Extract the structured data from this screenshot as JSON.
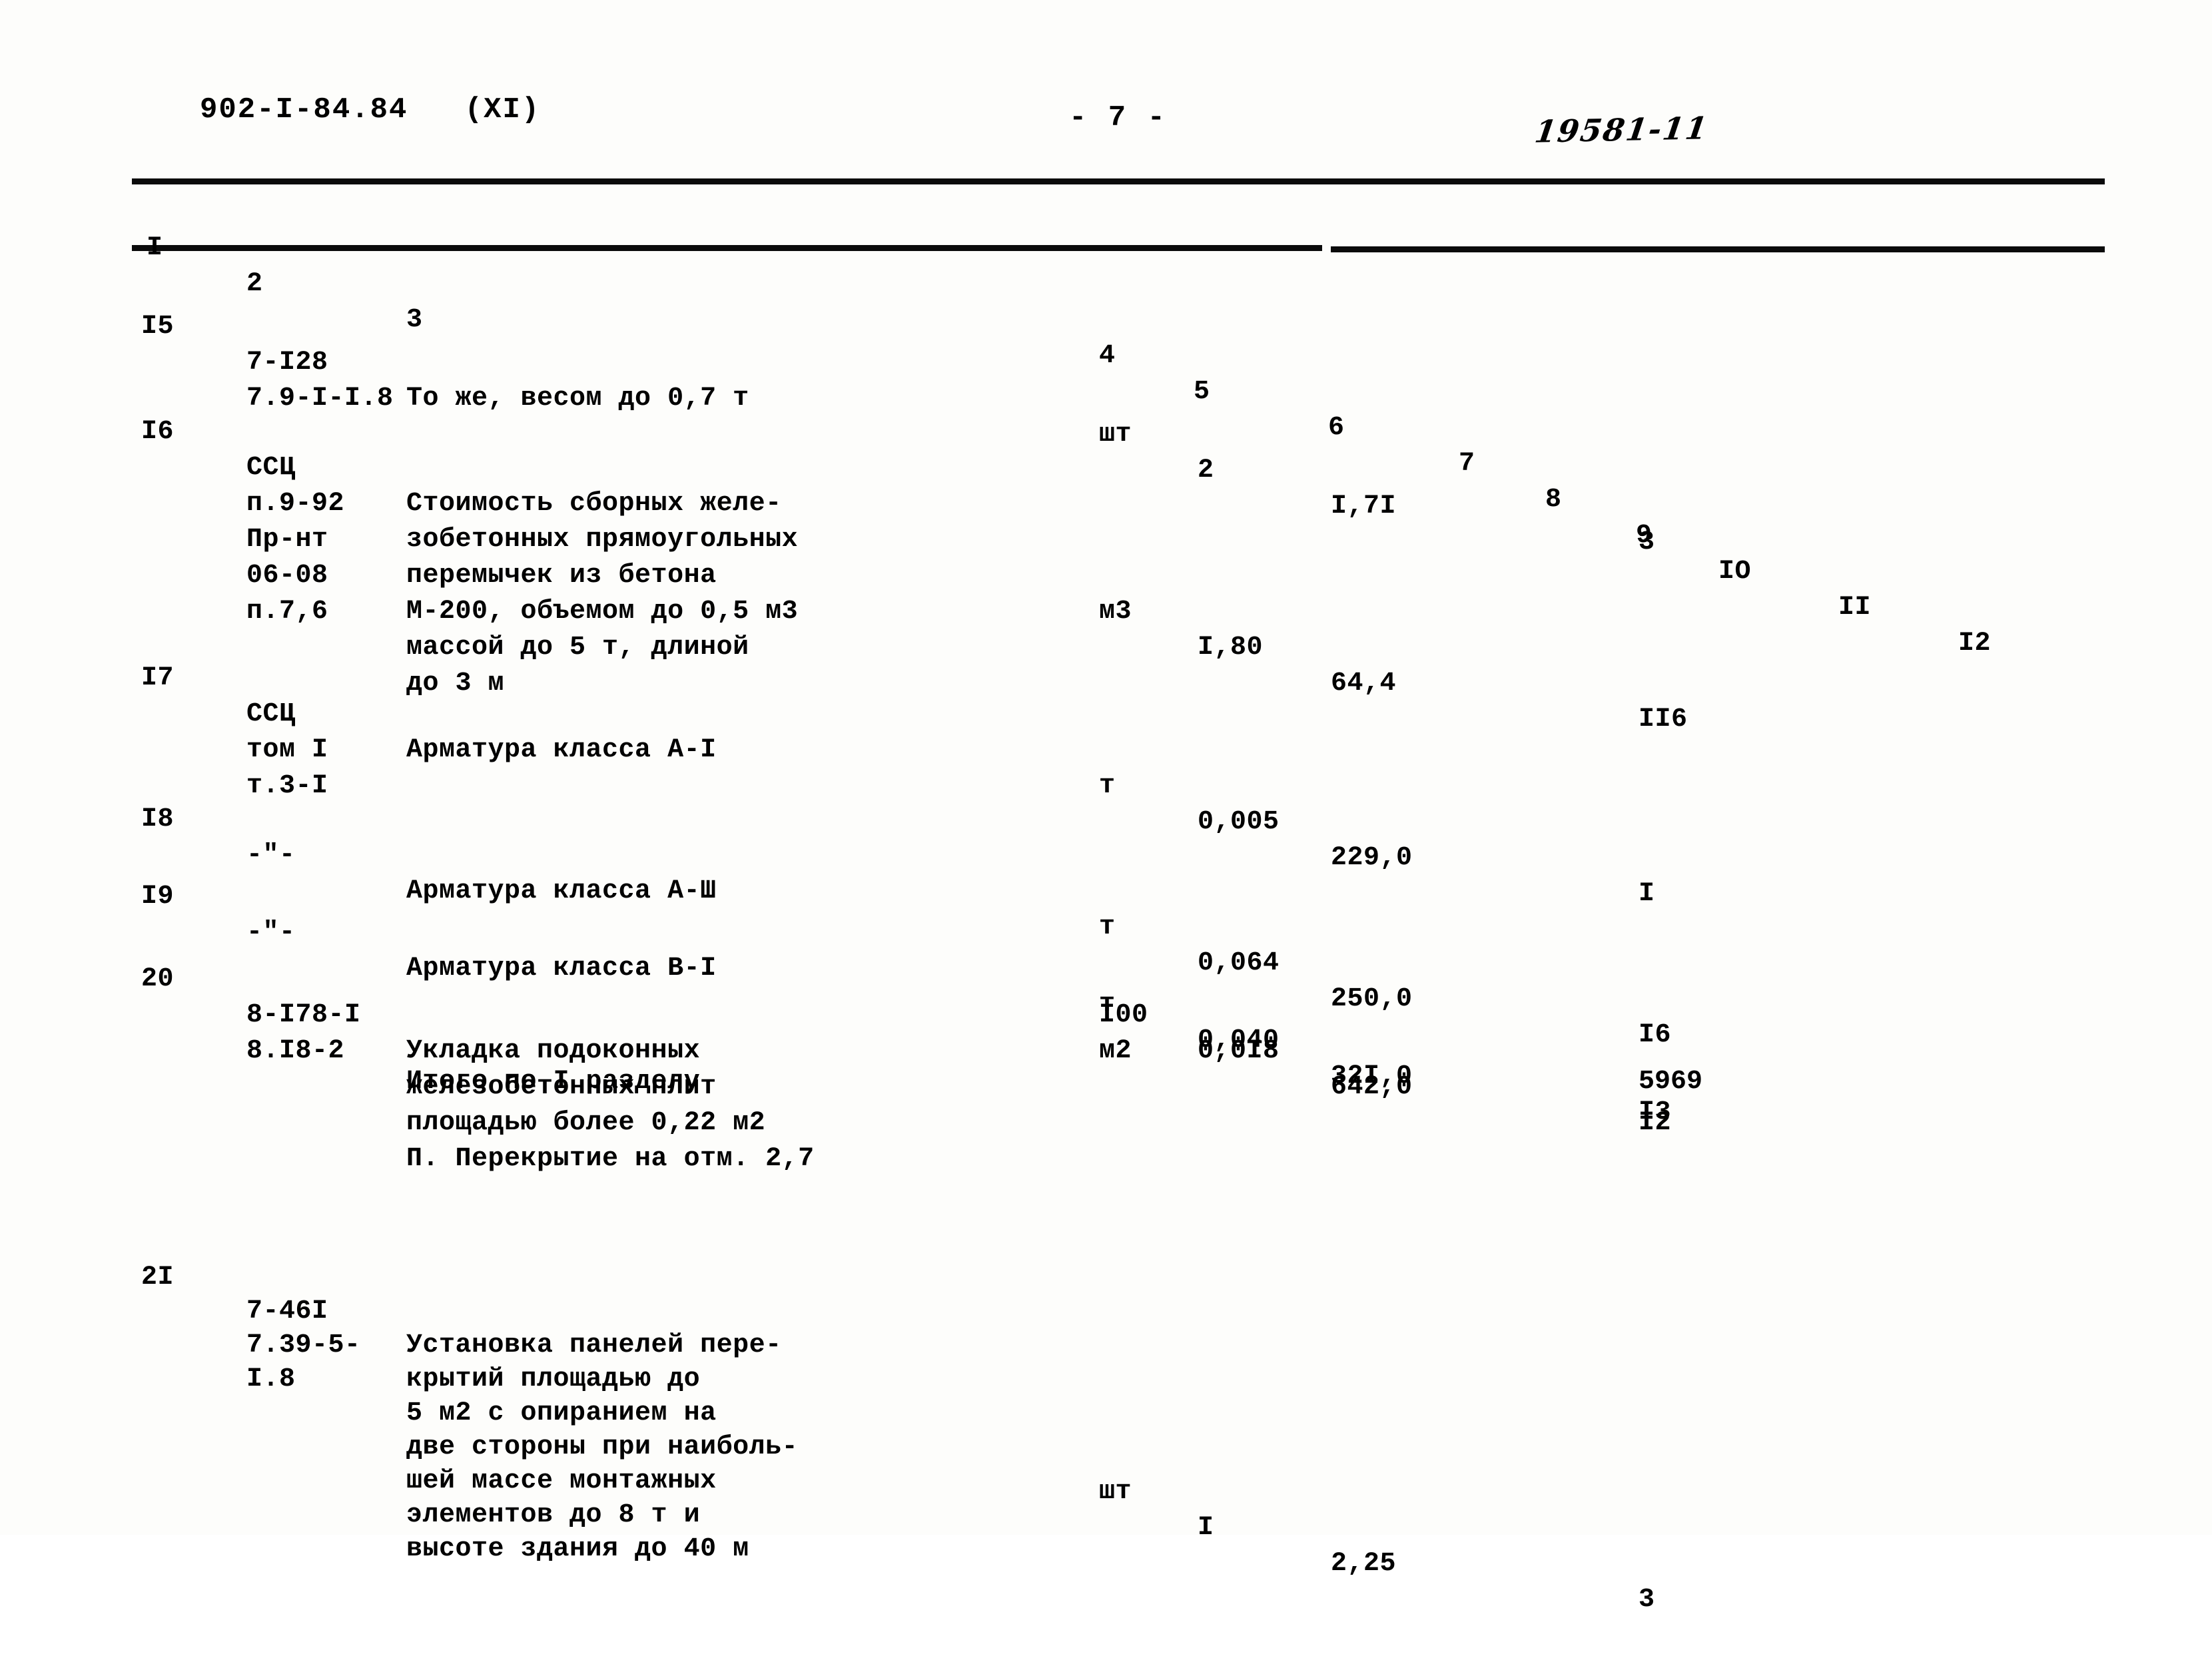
{
  "header": {
    "doc_code": "902-I-84.84   (XI)",
    "page_number": "- 7 -",
    "hand_code": "19581-11"
  },
  "table": {
    "column_headers": [
      "I",
      "2",
      "3",
      "4",
      "5",
      "6",
      "7",
      "8",
      "9",
      "IO",
      "II",
      "I2"
    ],
    "rows": [
      {
        "num": "I5",
        "code": "7-I28\n7.9-I-I.8",
        "desc": "То же, весом до 0,7 т",
        "unit": "шт",
        "qty": "2",
        "price": "I,7I",
        "total": "3"
      },
      {
        "num": "I6",
        "code": "ССЦ\nп.9-92\nПр-нт\n06-08\nп.7,6",
        "desc": "Стоимость сборных желе-\nзобетонных прямоугольных\nперемычек из бетона\nМ-200, объемом до 0,5 м3\nмассой до 5 т, длиной\nдо 3 м",
        "unit": "м3",
        "qty": "I,80",
        "price": "64,4",
        "total": "II6"
      },
      {
        "num": "I7",
        "code": "ССЦ\nтом I\nт.3-I",
        "desc": "Арматура класса А-I",
        "unit": "т",
        "qty": "0,005",
        "price": "229,0",
        "total": "I"
      },
      {
        "num": "I8",
        "code": "-\"-",
        "desc": "Арматура класса А-Ш",
        "unit": "т",
        "qty": "0,064",
        "price": "250,0",
        "total": "I6"
      },
      {
        "num": "I9",
        "code": "-\"-",
        "desc": "Арматура класса В-I",
        "unit": "т",
        "qty": "0,040",
        "price": "32I,0",
        "total": "I3"
      },
      {
        "num": "20",
        "code": "8-I78-I\n8.I8-2",
        "desc": "Укладка подоконных\nжелезобетонных плит\nплощадью более 0,22 м2",
        "unit": "I00\nм2",
        "qty": "0,0I8",
        "price": "642,0",
        "total": "I2"
      },
      {
        "num": "2I",
        "code": "7-46I\n7.39-5-\nI.8",
        "desc": "Установка панелей пере-\nкрытий площадью до\n5 м2 с опиранием на\nдве стороны при наиболь-\nшей массе монтажных\nэлементов до 8 т и\nвысоте здания до 40 м",
        "unit": "шт",
        "qty": "I",
        "price": "2,25",
        "total": "3"
      }
    ],
    "section_subtotal": {
      "label": "Итого по I разделу",
      "value": "5969"
    },
    "section_heading": "П. Перекрытие на отм. 2,7"
  }
}
